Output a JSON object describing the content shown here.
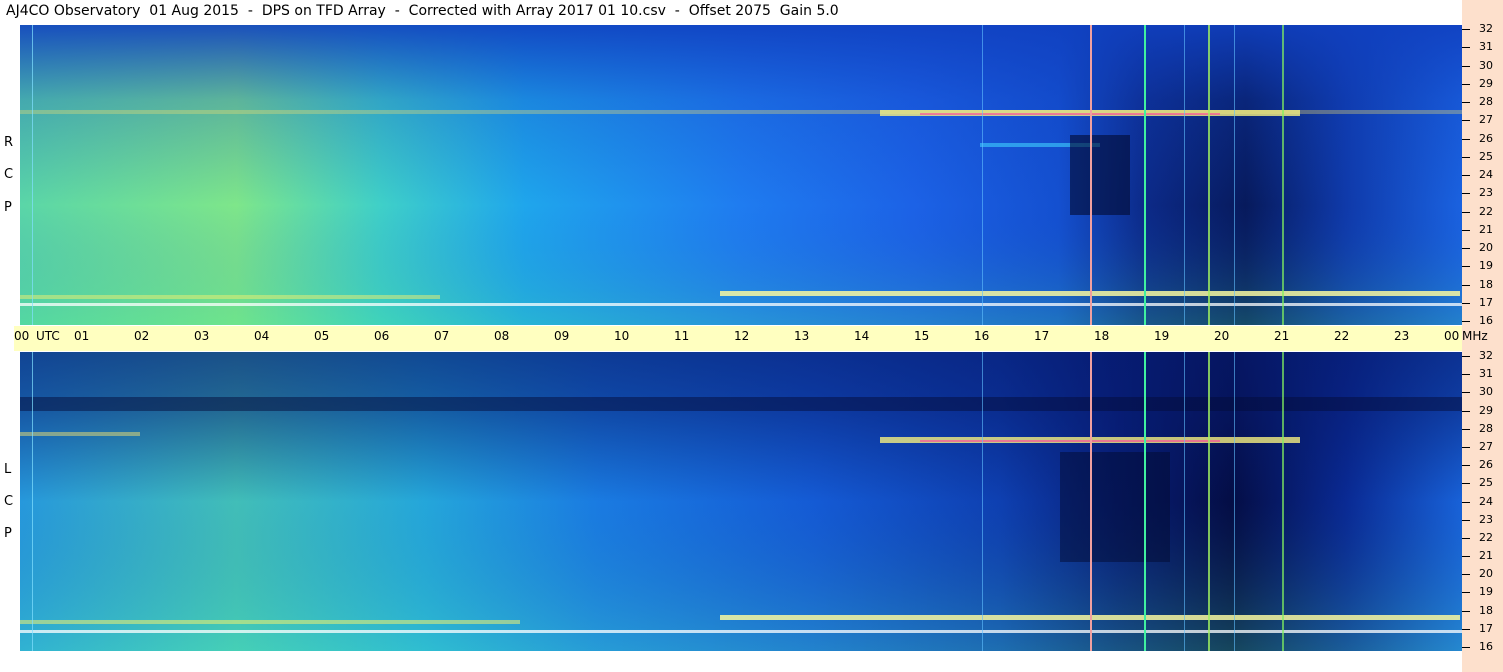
{
  "title": "AJ4CO Observatory  01 Aug 2015  -  DPS on TFD Array  -  Corrected with Array 2017 01 10.csv  -  Offset 2075  Gain 5.0",
  "rcp_letters": [
    "R",
    "C",
    "P"
  ],
  "lcp_letters": [
    "L",
    "C",
    "P"
  ],
  "colors": {
    "base_blue": "#1a6af0",
    "deep_blue": "#0a1a6e",
    "cyan": "#22b8f0",
    "green": "#6fe090",
    "yellow": "#f0f070",
    "timebar_bg": "#ffffc0",
    "right_bg": "#fde0cc"
  },
  "chart_data": [
    {
      "type": "heatmap",
      "panel": "RCP",
      "x_unit": "UTC hour",
      "xlim": [
        0,
        24
      ],
      "ylabel": "MHz",
      "ylim": [
        16,
        32
      ],
      "y_ticks": [
        "32",
        "31",
        "30",
        "29",
        "28",
        "27",
        "26",
        "25",
        "24",
        "23",
        "22",
        "21",
        "20",
        "19",
        "18",
        "17",
        "16"
      ],
      "bright_bands_mhz": [
        27,
        17.6,
        16.8
      ],
      "vertical_lines_utc": [
        16.0,
        16.3,
        17.9,
        18.8,
        19.4,
        19.8,
        20.2,
        21.1
      ]
    },
    {
      "type": "heatmap",
      "panel": "LCP",
      "x_unit": "UTC hour",
      "xlim": [
        0,
        24
      ],
      "ylabel": "MHz",
      "ylim": [
        16,
        32
      ],
      "y_ticks": [
        "32",
        "31",
        "30",
        "29",
        "28",
        "27",
        "26",
        "25",
        "24",
        "23",
        "22",
        "21",
        "20",
        "19",
        "18",
        "17",
        "16"
      ],
      "bright_bands_mhz": [
        27,
        17.6,
        16.8
      ],
      "vertical_lines_utc": [
        16.0,
        16.3,
        17.9,
        18.8,
        19.4,
        19.8,
        20.2,
        21.1
      ]
    }
  ],
  "time_axis": {
    "labels": [
      "00",
      "UTC",
      "01",
      "02",
      "03",
      "04",
      "05",
      "06",
      "07",
      "08",
      "09",
      "10",
      "11",
      "12",
      "13",
      "14",
      "15",
      "16",
      "17",
      "18",
      "19",
      "20",
      "21",
      "22",
      "23",
      "00",
      "MHz"
    ]
  }
}
